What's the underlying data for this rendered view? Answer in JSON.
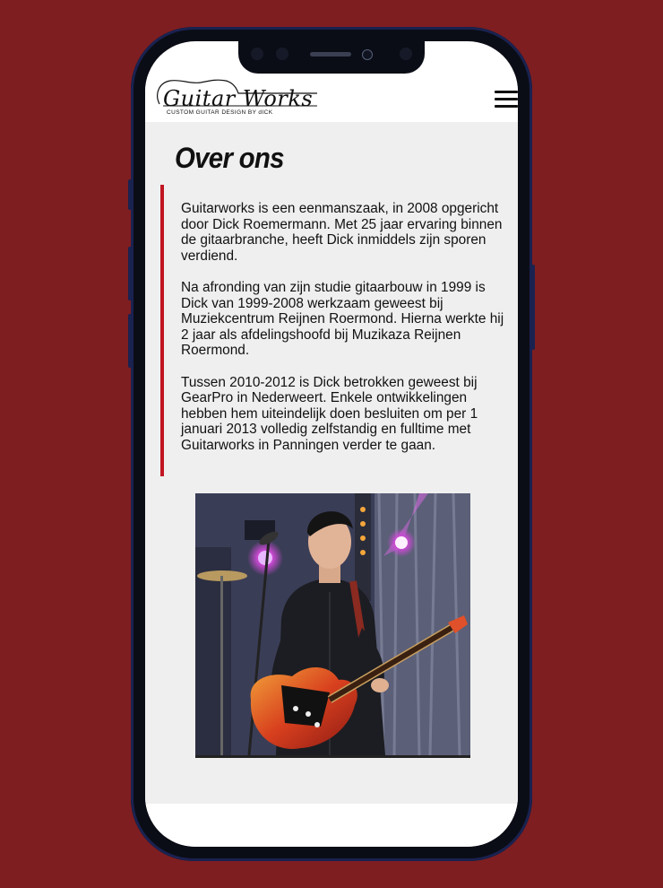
{
  "logo": {
    "text": "Guitar Works",
    "tagline": "CUSTOM GUITAR DESIGN BY dICK"
  },
  "menu": {
    "icon": "hamburger-menu-icon"
  },
  "page": {
    "title": "Over ons",
    "paragraphs": [
      "Guitarworks is een eenmanszaak, in 2008 opgericht door Dick Roemermann. Met 25 jaar ervaring binnen de gitaarbranche, heeft Dick inmiddels zijn sporen verdiend.",
      "Na afronding van zijn studie gitaarbouw in 1999 is Dick van 1999-2008 werkzaam geweest bij Muziekcentrum Reijnen Roermond. Hierna werkte hij 2 jaar als afdelingshoofd bij Muzikaza Reijnen Roermond.",
      "Tussen 2010-2012 is Dick betrokken geweest bij GearPro in Nederweert. Enkele ontwikkelingen hebben hem uiteindelijk doen besluiten om per 1 januari 2013 volledig zelfstandig en fulltime met Guitarworks in Panningen verder te gaan."
    ]
  },
  "colors": {
    "background": "#7e1e20",
    "accent": "#c01622",
    "content_bg": "#efefef"
  }
}
